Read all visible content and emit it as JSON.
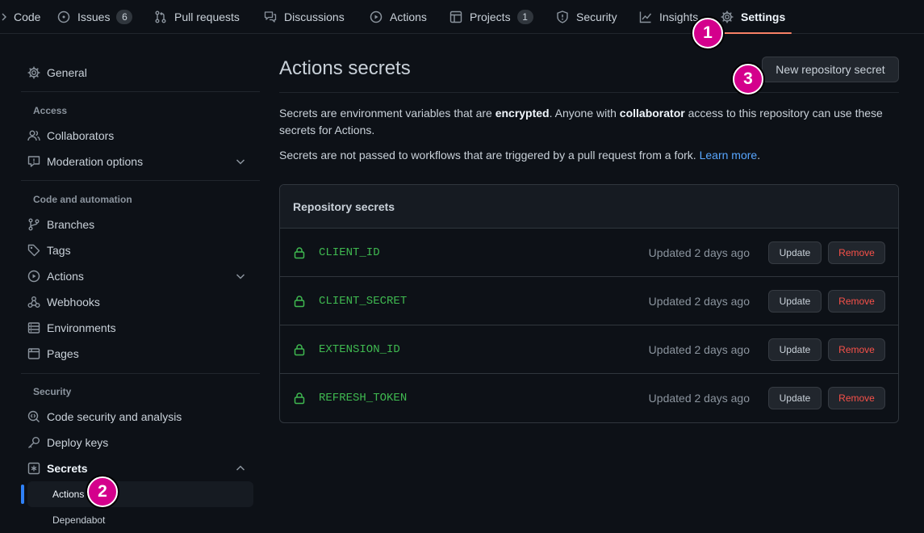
{
  "nav": {
    "tabs": [
      {
        "label": "Code"
      },
      {
        "label": "Issues",
        "count": "6"
      },
      {
        "label": "Pull requests"
      },
      {
        "label": "Discussions"
      },
      {
        "label": "Actions"
      },
      {
        "label": "Projects",
        "count": "1"
      },
      {
        "label": "Security"
      },
      {
        "label": "Insights"
      },
      {
        "label": "Settings"
      }
    ],
    "selected": "Settings"
  },
  "markers": [
    "1",
    "2",
    "3"
  ],
  "sidebar": {
    "general": "General",
    "access_heading": "Access",
    "collaborators": "Collaborators",
    "moderation": "Moderation options",
    "code_heading": "Code and automation",
    "branches": "Branches",
    "tags": "Tags",
    "actions": "Actions",
    "webhooks": "Webhooks",
    "environments": "Environments",
    "pages": "Pages",
    "security_heading": "Security",
    "code_security": "Code security and analysis",
    "deploy_keys": "Deploy keys",
    "secrets": "Secrets",
    "secrets_actions": "Actions",
    "secrets_dependabot": "Dependabot"
  },
  "main": {
    "title": "Actions secrets",
    "new_button": "New repository secret",
    "desc1_a": "Secrets are environment variables that are ",
    "desc1_b": "encrypted",
    "desc1_c": ". Anyone with ",
    "desc1_d": "collaborator",
    "desc1_e": " access to this repository can use these secrets for Actions.",
    "desc2": "Secrets are not passed to workflows that are triggered by a pull request from a fork. ",
    "learn_more": "Learn more",
    "desc2_end": ".",
    "box_title": "Repository secrets",
    "update_label": "Update",
    "remove_label": "Remove",
    "secrets": [
      {
        "name": "CLIENT_ID",
        "updated": "Updated 2 days ago"
      },
      {
        "name": "CLIENT_SECRET",
        "updated": "Updated 2 days ago"
      },
      {
        "name": "EXTENSION_ID",
        "updated": "Updated 2 days ago"
      },
      {
        "name": "REFRESH_TOKEN",
        "updated": "Updated 2 days ago"
      }
    ]
  },
  "colors": {
    "background": "#0d1117",
    "accent_tab": "#f78166",
    "link": "#58a6ff",
    "secret_name": "#3fb950",
    "danger": "#f85149",
    "marker": "#d4008c"
  },
  "icons": {
    "code": "code-icon",
    "issues": "issue-opened-icon",
    "pulls": "git-pull-request-icon",
    "discussions": "comment-discussion-icon",
    "actions": "play-icon",
    "projects": "table-icon",
    "security": "shield-icon",
    "insights": "graph-icon",
    "settings": "gear-icon",
    "people": "people-icon",
    "moderation": "report-icon",
    "branch": "git-branch-icon",
    "tag": "tag-icon",
    "webhook": "webhook-icon",
    "environment": "server-icon",
    "browser": "browser-icon",
    "codescan": "codescan-icon",
    "key": "key-icon",
    "asterisk": "key-asterisk-icon",
    "lock": "lock-icon",
    "chevron": "chevron-icon"
  }
}
